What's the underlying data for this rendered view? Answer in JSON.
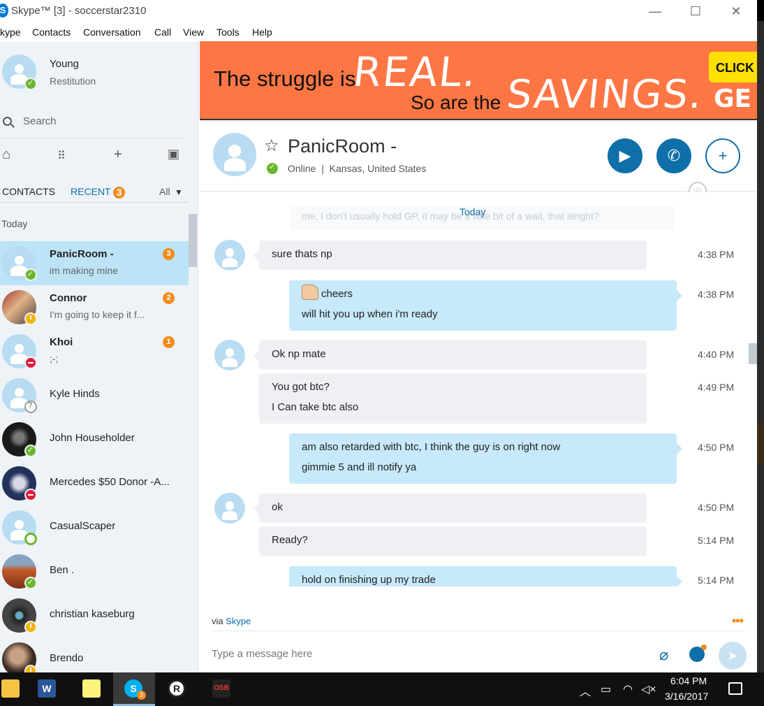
{
  "window": {
    "title": "Skype™ [3] - soccerstar2310",
    "minimize": "—",
    "maximize": "☐",
    "close": "✕"
  },
  "menu": [
    "kype",
    "Contacts",
    "Conversation",
    "Call",
    "View",
    "Tools",
    "Help"
  ],
  "me": {
    "name": "Young",
    "mood": "Restitution",
    "status": "online"
  },
  "search": {
    "placeholder": "Search"
  },
  "nav_icons": [
    "home-icon",
    "dialpad-icon",
    "add-icon",
    "bot-icon"
  ],
  "tabs": {
    "contacts": "CONTACTS",
    "recent": "RECENT",
    "recent_badge": "3",
    "filter": "All"
  },
  "section": "Today",
  "contacts": [
    {
      "name": "PanicRoom -",
      "message": "im making mine",
      "badge": "3",
      "status": "online",
      "active": true
    },
    {
      "name": "Connor",
      "message": "I'm going to keep it f...",
      "badge": "2",
      "status": "away"
    },
    {
      "name": "Khoi",
      "message": ";-;",
      "badge": "1",
      "status": "busy"
    },
    {
      "name": "Kyle Hinds",
      "status": "unknown"
    },
    {
      "name": "John Householder",
      "status": "online"
    },
    {
      "name": "Mercedes $50 Donor -A...",
      "status": "busy"
    },
    {
      "name": "CasualScaper",
      "status": "offline"
    },
    {
      "name": "Ben .",
      "status": "online"
    },
    {
      "name": "christian kaseburg",
      "status": "away"
    },
    {
      "name": "Brendo",
      "status": "away"
    }
  ],
  "ad": {
    "line1": "The struggle is",
    "real": "REAL.",
    "line2": "So are the",
    "savings": "SAVINGS.",
    "cta": "CLICK T",
    "tail": "GE",
    "bg_color": "#ff7645"
  },
  "peer": {
    "name": "PanicRoom -",
    "status": "Online",
    "location": "Kansas, United States"
  },
  "call_buttons": [
    "video-call-icon",
    "audio-call-icon",
    "add-person-icon"
  ],
  "chat": {
    "faded_text": "me, I don't usually hold GP, it may be a little bit of a wait, that alright?",
    "date_label": "Today",
    "messages": [
      {
        "dir": "in",
        "lines": [
          "sure thats np"
        ],
        "time": "4:38 PM"
      },
      {
        "dir": "out",
        "lines": [
          "cheers",
          "will hit you up when i'm ready"
        ],
        "time": "4:38 PM"
      },
      {
        "dir": "in",
        "lines": [
          "Ok np mate"
        ],
        "time": "4:40 PM"
      },
      {
        "dir": "in",
        "lines": [
          "You got btc?",
          "I Can take btc also"
        ],
        "time": "4:49 PM"
      },
      {
        "dir": "out",
        "lines": [
          "am also retarded with btc, I think the guy is on right now",
          "gimmie 5 and ill notify ya"
        ],
        "time": "4:50 PM"
      },
      {
        "dir": "in",
        "lines": [
          "ok"
        ],
        "time": "4:50 PM"
      },
      {
        "dir": "in",
        "lines": [
          "Ready?"
        ],
        "time": "5:14 PM"
      },
      {
        "dir": "out",
        "lines": [
          "hold on finishing up my trade"
        ],
        "time": "5:14 PM"
      }
    ]
  },
  "compose": {
    "via": "via",
    "via_link": "Skype",
    "placeholder": "Type a message here",
    "more": "•••"
  },
  "taskbar": {
    "apps": [
      "file-explorer-icon",
      "word-icon",
      "sticky-notes-icon",
      "skype-icon",
      "runelite-icon",
      "osb-icon"
    ],
    "skype_badge": "3",
    "osb_label": "OSB",
    "time": "6:04 PM",
    "date": "3/16/2017"
  },
  "colors": {
    "accent": "#0f6fa8",
    "badge": "#f28b1e",
    "online": "#6cb52d",
    "busy": "#e01e3c",
    "away": "#f5b400"
  }
}
